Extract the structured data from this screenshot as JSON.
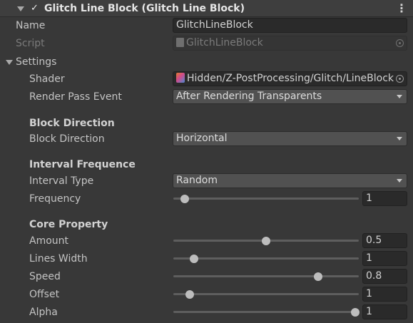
{
  "header": {
    "title": "Glitch Line Block (Glitch Line Block)",
    "enabled_mark": "✓",
    "menu": "⋮"
  },
  "name": {
    "label": "Name",
    "value": "GlitchLineBlock"
  },
  "script": {
    "label": "Script",
    "value": "GlitchLineBlock"
  },
  "settings": {
    "label": "Settings",
    "shader": {
      "label": "Shader",
      "value": "Hidden/Z-PostProcessing/Glitch/LineBlock"
    },
    "render_pass": {
      "label": "Render Pass Event",
      "value": "After Rendering Transparents"
    },
    "block_direction_section": "Block Direction",
    "block_direction": {
      "label": "Block Direction",
      "value": "Horizontal"
    },
    "interval_section": "Interval Frequence",
    "interval_type": {
      "label": "Interval Type",
      "value": "Random"
    },
    "frequency": {
      "label": "Frequency",
      "value": "1",
      "fraction": 0.06
    },
    "core_section": "Core Property",
    "amount": {
      "label": "Amount",
      "value": "0.5",
      "fraction": 0.5
    },
    "lines_width": {
      "label": "Lines Width",
      "value": "1",
      "fraction": 0.11
    },
    "speed": {
      "label": "Speed",
      "value": "0.8",
      "fraction": 0.78
    },
    "offset": {
      "label": "Offset",
      "value": "1",
      "fraction": 0.09
    },
    "alpha": {
      "label": "Alpha",
      "value": "1",
      "fraction": 0.98
    }
  },
  "icons": {
    "header_fold": "triangle-down-icon",
    "settings_fold": "triangle-down-icon",
    "script_file": "script-file-icon",
    "shader_file": "shader-icon",
    "object_picker": "object-picker-icon",
    "dropdown_caret": "chevron-down-icon",
    "menu": "kebab-menu-icon"
  },
  "colors": {
    "background": "#383838",
    "field": "#2a2a2a",
    "dropdown": "#515151",
    "text": "#c4c4c4"
  }
}
